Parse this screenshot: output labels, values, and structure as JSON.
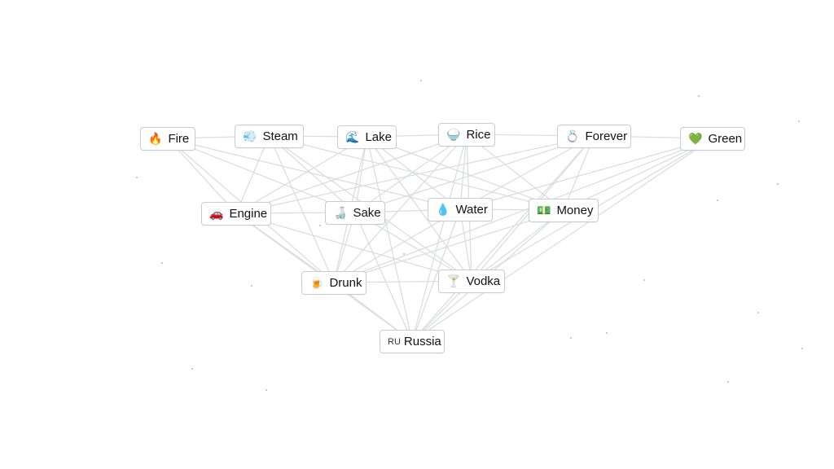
{
  "nodes": [
    {
      "id": "fire",
      "label": "Fire",
      "icon": "fire-icon",
      "emoji": "🔥"
    },
    {
      "id": "steam",
      "label": "Steam",
      "icon": "steam-icon",
      "emoji": "💨"
    },
    {
      "id": "lake",
      "label": "Lake",
      "icon": "wave-icon",
      "emoji": "🌊"
    },
    {
      "id": "rice",
      "label": "Rice",
      "icon": "rice-bowl-icon",
      "emoji": "🍚"
    },
    {
      "id": "forever",
      "label": "Forever",
      "icon": "ring-icon",
      "emoji": "💍"
    },
    {
      "id": "green",
      "label": "Green",
      "icon": "green-heart-icon",
      "emoji": "💚"
    },
    {
      "id": "engine",
      "label": "Engine",
      "icon": "car-icon",
      "emoji": "🚗"
    },
    {
      "id": "sake",
      "label": "Sake",
      "icon": "sake-icon",
      "emoji": "🍶"
    },
    {
      "id": "water",
      "label": "Water",
      "icon": "droplet-icon",
      "emoji": "💧"
    },
    {
      "id": "money",
      "label": "Money",
      "icon": "money-icon",
      "emoji": "💵"
    },
    {
      "id": "drunk",
      "label": "Drunk",
      "icon": "beer-mug-icon",
      "emoji": "🍺"
    },
    {
      "id": "vodka",
      "label": "Vodka",
      "icon": "cocktail-icon",
      "emoji": "🍸"
    },
    {
      "id": "russia",
      "label": "Russia",
      "icon": "flag-ru-icon",
      "emoji": "RU"
    }
  ],
  "edges": [
    [
      "fire",
      "steam"
    ],
    [
      "steam",
      "lake"
    ],
    [
      "lake",
      "rice"
    ],
    [
      "rice",
      "forever"
    ],
    [
      "forever",
      "green"
    ],
    [
      "fire",
      "engine"
    ],
    [
      "steam",
      "engine"
    ],
    [
      "fire",
      "drunk"
    ],
    [
      "fire",
      "sake"
    ],
    [
      "fire",
      "water"
    ],
    [
      "steam",
      "sake"
    ],
    [
      "steam",
      "drunk"
    ],
    [
      "steam",
      "vodka"
    ],
    [
      "steam",
      "money"
    ],
    [
      "lake",
      "sake"
    ],
    [
      "lake",
      "water"
    ],
    [
      "lake",
      "drunk"
    ],
    [
      "lake",
      "vodka"
    ],
    [
      "lake",
      "money"
    ],
    [
      "lake",
      "engine"
    ],
    [
      "lake",
      "russia"
    ],
    [
      "rice",
      "sake"
    ],
    [
      "rice",
      "water"
    ],
    [
      "rice",
      "vodka"
    ],
    [
      "rice",
      "drunk"
    ],
    [
      "rice",
      "engine"
    ],
    [
      "rice",
      "russia"
    ],
    [
      "rice",
      "money"
    ],
    [
      "forever",
      "sake"
    ],
    [
      "forever",
      "water"
    ],
    [
      "forever",
      "vodka"
    ],
    [
      "forever",
      "money"
    ],
    [
      "forever",
      "russia"
    ],
    [
      "forever",
      "engine"
    ],
    [
      "green",
      "money"
    ],
    [
      "green",
      "vodka"
    ],
    [
      "green",
      "water"
    ],
    [
      "green",
      "russia"
    ],
    [
      "green",
      "drunk"
    ],
    [
      "engine",
      "sake"
    ],
    [
      "sake",
      "water"
    ],
    [
      "water",
      "money"
    ],
    [
      "engine",
      "drunk"
    ],
    [
      "engine",
      "vodka"
    ],
    [
      "sake",
      "drunk"
    ],
    [
      "sake",
      "vodka"
    ],
    [
      "sake",
      "russia"
    ],
    [
      "water",
      "drunk"
    ],
    [
      "water",
      "vodka"
    ],
    [
      "water",
      "russia"
    ],
    [
      "money",
      "drunk"
    ],
    [
      "money",
      "vodka"
    ],
    [
      "money",
      "russia"
    ],
    [
      "drunk",
      "vodka"
    ],
    [
      "drunk",
      "russia"
    ],
    [
      "vodka",
      "russia"
    ],
    [
      "engine",
      "russia"
    ]
  ]
}
